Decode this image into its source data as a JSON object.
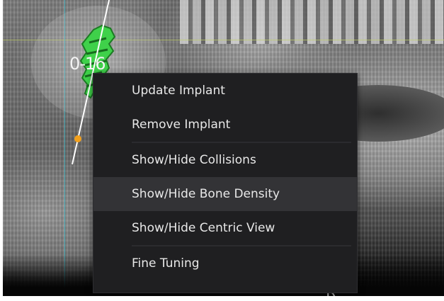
{
  "viewer": {
    "implant_label": "0-16",
    "corner_letter": "R"
  },
  "context_menu": {
    "groups": [
      [
        {
          "label": "Update Implant"
        },
        {
          "label": "Remove Implant"
        }
      ],
      [
        {
          "label": "Show/Hide Collisions"
        },
        {
          "label": "Show/Hide Bone Density",
          "highlighted": true
        },
        {
          "label": "Show/Hide Centric View"
        }
      ],
      [
        {
          "label": "Fine Tuning"
        }
      ]
    ]
  },
  "colors": {
    "implant": "#3fd14a",
    "axis_line": "#ffffff",
    "handle": "#f2a01c",
    "menu_bg": "#1f1f21",
    "menu_highlight": "#333336",
    "guide_horizontal": "#c6d46a",
    "guide_vertical": "#3bb7c4"
  }
}
